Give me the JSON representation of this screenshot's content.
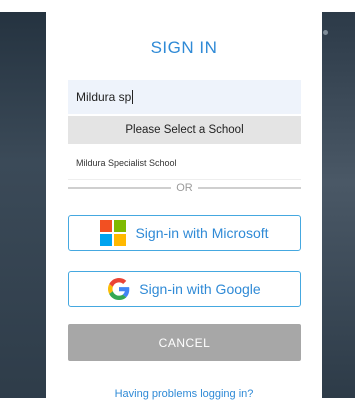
{
  "dialog": {
    "title": "SIGN IN",
    "search": {
      "value": "Mildura sp",
      "placeholder": ""
    },
    "dropdown": {
      "header": "Please Select a School",
      "options": [
        "Mildura Specialist School"
      ]
    },
    "divider_text": "OR",
    "microsoft_button": {
      "label": "Sign-in with Microsoft",
      "icon": "microsoft-logo-icon"
    },
    "google_button": {
      "label": "Sign-in with Google",
      "icon": "google-logo-icon"
    },
    "cancel_button": {
      "label": "CANCEL"
    },
    "help_link": "Having problems logging in?"
  },
  "colors": {
    "accent": "#2f8ad6",
    "button_border": "#45a8e0",
    "cancel_bg": "#a7a7a7",
    "backdrop": "#2b3947",
    "microsoft": [
      "#f25022",
      "#7fba00",
      "#00a4ef",
      "#ffb900"
    ],
    "google": [
      "#4285f4",
      "#ea4335",
      "#fbbc05",
      "#34a853"
    ]
  }
}
